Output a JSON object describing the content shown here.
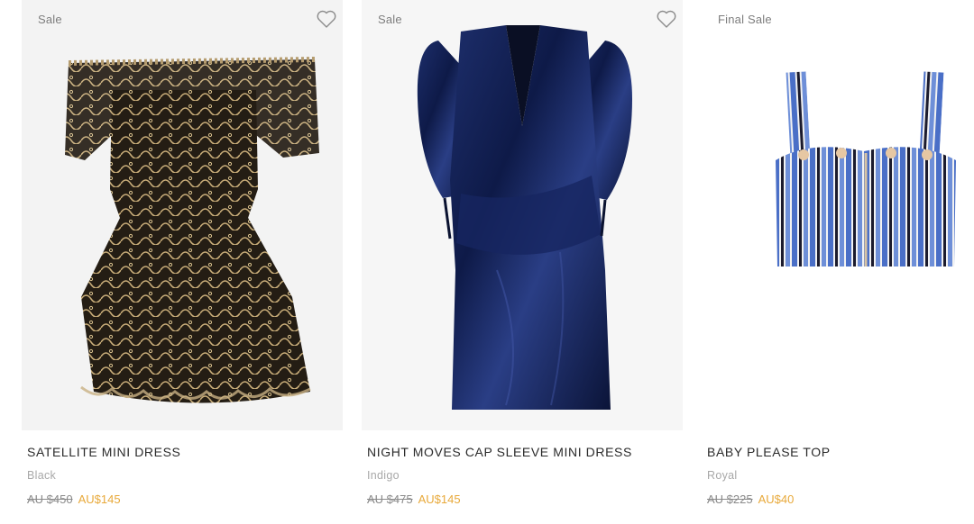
{
  "products": [
    {
      "badge": "Sale",
      "name": "SATELLITE MINI DRESS",
      "color": "Black",
      "original_price": "AU $450",
      "sale_price": "AU$145",
      "image_icon": "lace-off-shoulder-dress-image",
      "has_wishlist": true
    },
    {
      "badge": "Sale",
      "name": "NIGHT MOVES CAP SLEEVE MINI DRESS",
      "color": "Indigo",
      "original_price": "AU $475",
      "sale_price": "AU$145",
      "image_icon": "velvet-wrap-dress-image",
      "has_wishlist": true
    },
    {
      "badge": "Final Sale",
      "name": "BABY PLEASE TOP",
      "color": "Royal",
      "original_price": "AU $225",
      "sale_price": "AU$40",
      "image_icon": "striped-bustier-top-image",
      "has_wishlist": false
    }
  ],
  "colors": {
    "sale_price": "#e8a93a",
    "old_price": "#8a8a8a",
    "muted_text": "#a8a8a8",
    "title_text": "#2b2b2b"
  }
}
